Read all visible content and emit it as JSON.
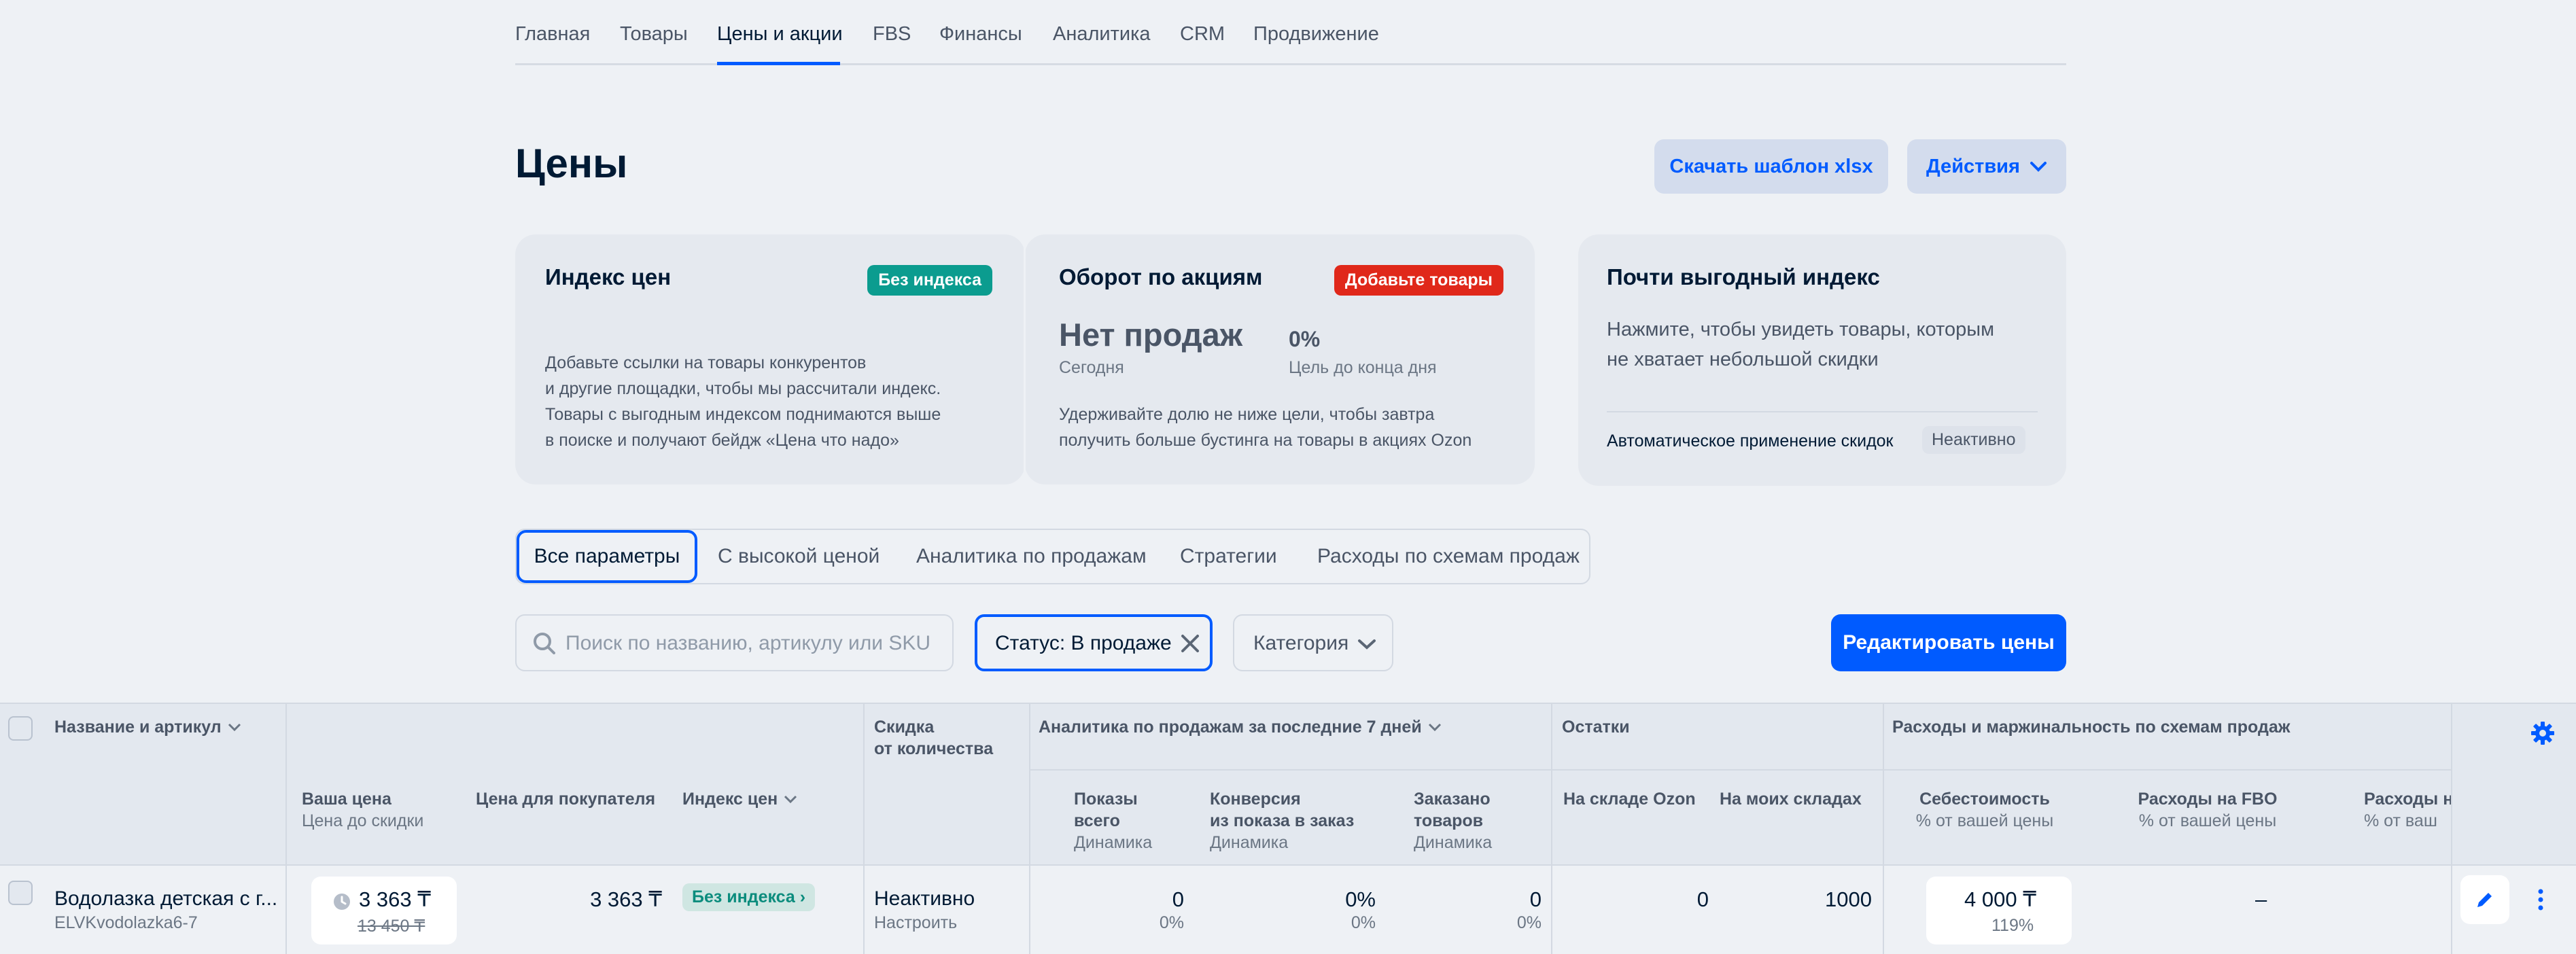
{
  "nav": {
    "tabs": [
      "Главная",
      "Товары",
      "Цены и акции",
      "FBS",
      "Финансы",
      "Аналитика",
      "CRM",
      "Продвижение"
    ],
    "active_index": 2
  },
  "page": {
    "title": "Цены",
    "download_btn": "Скачать шаблон xlsx",
    "actions_btn": "Действия"
  },
  "cards": {
    "price_index": {
      "title": "Индекс цен",
      "badge": "Без индекса",
      "text": [
        "Добавьте ссылки на товары конкурентов",
        "и другие площадки, чтобы мы рассчитали индекс.",
        "Товары с выгодным индексом поднимаются выше",
        "в поиске и получают бейдж «Цена что надо»"
      ]
    },
    "promo_turnover": {
      "title": "Оборот по акциям",
      "badge": "Добавьте товары",
      "value": "Нет продаж",
      "value_caption": "Сегодня",
      "goal": "0%",
      "goal_caption": "Цель до конца дня",
      "text": [
        "Удерживайте долю не ниже цели, чтобы завтра",
        "получить больше бустинга на товары в акциях Ozon"
      ]
    },
    "almost_index": {
      "title": "Почти выгодный индекс",
      "text": [
        "Нажмите, чтобы увидеть товары, которым",
        "не хватает небольшой скидки"
      ],
      "auto_label": "Автоматическое применение скидок",
      "auto_status": "Неактивно"
    }
  },
  "segments": [
    "Все параметры",
    "С высокой ценой",
    "Аналитика по продажам",
    "Стратегии",
    "Расходы по схемам продаж"
  ],
  "filters": {
    "search_placeholder": "Поиск по названию, артикулу или SKU",
    "status_chip": "Статус: В продаже",
    "category": "Категория",
    "edit_prices_btn": "Редактировать цены"
  },
  "table": {
    "headers": {
      "name": "Название и артикул",
      "qty_discount_1": "Скидка",
      "qty_discount_2": "от количества",
      "analytics_group": "Аналитика по продажам за последние 7 дней",
      "stock_group": "Остатки",
      "expenses_group": "Расходы и маржинальность по схемам продаж",
      "your_price": "Ваша цена",
      "your_price_sub": "Цена до скидки",
      "buyer_price": "Цена для покупателя",
      "price_index": "Индекс цен",
      "views_1": "Показы",
      "views_2": "всего",
      "views_sub": "Динамика",
      "conv_1": "Конверсия",
      "conv_2": "из показа в заказ",
      "conv_sub": "Динамика",
      "ordered_1": "Заказано",
      "ordered_2": "товаров",
      "ordered_sub": "Динамика",
      "ozon_stock": "На складе Ozon",
      "my_stock": "На моих складах",
      "cost": "Себестоимость",
      "cost_sub": "% от вашей цены",
      "fbo": "Расходы на FBO",
      "fbo_sub": "% от вашей цены",
      "fbs": "Расходы н",
      "fbs_sub": "% от ваш"
    },
    "rows": [
      {
        "name": "Водолазка детская с г...",
        "sku": "ELVKvodolazka6-7",
        "your_price": "3 363 ₸",
        "old_price": "13 450 ₸",
        "buyer_price": "3 363 ₸",
        "index": "Без индекса",
        "qty_discount": "Неактивно",
        "qty_discount_link": "Настроить",
        "views": "0",
        "views_dyn": "0%",
        "conv": "0%",
        "conv_dyn": "0%",
        "ordered": "0",
        "ordered_dyn": "0%",
        "ozon_stock": "0",
        "my_stock": "1000",
        "cost": "4 000 ₸",
        "cost_pct": "119%",
        "fbo": "–"
      }
    ]
  },
  "colors": {
    "accent": "#005bff",
    "badge_teal": "#0b9c8f",
    "badge_red": "#e0281a"
  }
}
